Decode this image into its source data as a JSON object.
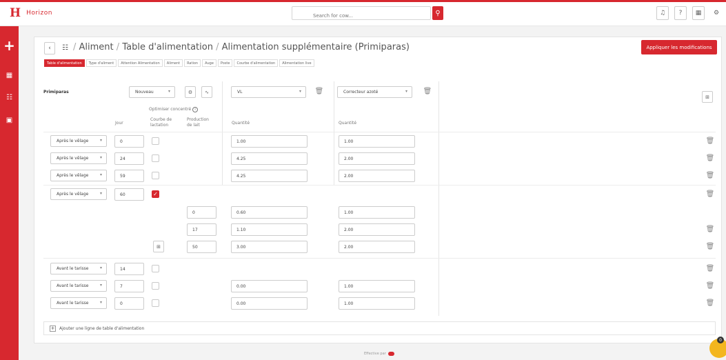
{
  "app": {
    "logo_letter": "H",
    "name": "Horizon"
  },
  "search": {
    "placeholder": "Search for cow..."
  },
  "topbar_buttons": [
    "bell-icon",
    "help-icon",
    "grid-icon",
    "gear-icon"
  ],
  "breadcrumb": {
    "items": [
      "Aliment",
      "Table d'alimentation",
      "Alimentation supplémentaire (Primiparas)"
    ],
    "separator": "/"
  },
  "apply_button": "Appliquer les modifications",
  "tabs": [
    {
      "label": "Table d'alimentation",
      "active": true
    },
    {
      "label": "Type d'aliment",
      "active": false
    },
    {
      "label": "Attention Alimentation",
      "active": false
    },
    {
      "label": "Aliment",
      "active": false
    },
    {
      "label": "Ration",
      "active": false
    },
    {
      "label": "Auge",
      "active": false
    },
    {
      "label": "Poste",
      "active": false
    },
    {
      "label": "Courbe d'alimentation",
      "active": false
    },
    {
      "label": "Alimentation live",
      "active": false
    }
  ],
  "table": {
    "group_label": "Primiparas",
    "nouveau_select": "Nouveau",
    "optimiser_label": "Optimiser concentré",
    "info_icon": "i",
    "col_jour": "Jour",
    "col_courbe": "Courbe de lactation",
    "col_production": "Production de lait",
    "feed1": {
      "name": "VL",
      "quantity_header": "Quantité"
    },
    "feed2": {
      "name": "Correcteur azoté",
      "quantity_header": "Quantité"
    },
    "rows": [
      {
        "period": "Après le vêlage",
        "day": "0",
        "checked": false,
        "q1": "1.00",
        "q2": "1.00"
      },
      {
        "period": "Après le vêlage",
        "day": "24",
        "checked": false,
        "q1": "4.25",
        "q2": "2.00"
      },
      {
        "period": "Après le vêlage",
        "day": "59",
        "checked": false,
        "q1": "4.25",
        "q2": "2.00"
      },
      {
        "period": "Après le vêlage",
        "day": "60",
        "checked": true,
        "q1": "",
        "q2": ""
      }
    ],
    "subrows": [
      {
        "production": "0",
        "q1": "0.60",
        "q2": "1.00"
      },
      {
        "production": "17",
        "q1": "1.10",
        "q2": "2.00"
      },
      {
        "production": "50",
        "q1": "3.00",
        "q2": "2.00"
      }
    ],
    "rows_after": [
      {
        "period": "Avant le tarisse",
        "day": "14",
        "checked": false,
        "q1": "",
        "q2": ""
      },
      {
        "period": "Avant le tarisse",
        "day": "7",
        "checked": false,
        "q1": "0.00",
        "q2": "1.00"
      },
      {
        "period": "Avant le tarisse",
        "day": "0",
        "checked": false,
        "q1": "0.00",
        "q2": "1.00"
      }
    ]
  },
  "add_row_label": "Ajouter une ligne de table d'alimentation",
  "footer": "Effective par",
  "help_badge": "0"
}
